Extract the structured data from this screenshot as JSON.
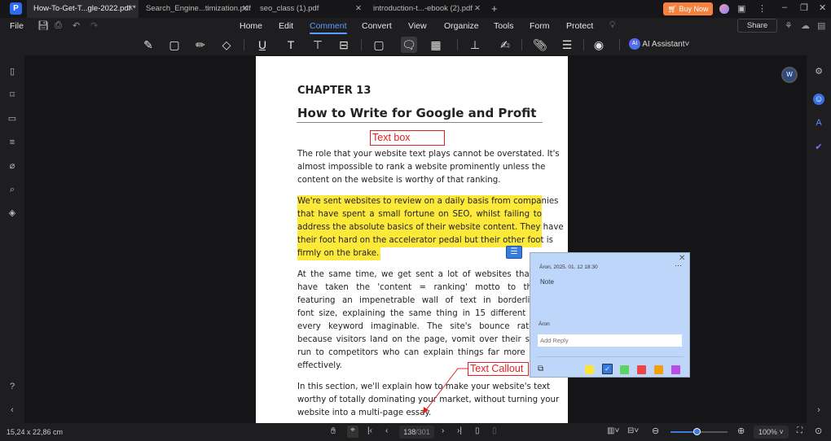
{
  "tabs": [
    {
      "label": "How-To-Get-T...gle-2022.pdf *",
      "active": true
    },
    {
      "label": "Search_Engine...timization.pdf"
    },
    {
      "label": "seo_class (1).pdf"
    },
    {
      "label": "introduction-t...-ebook (2).pdf"
    }
  ],
  "buy_now": "Buy Now",
  "menu": {
    "file": "File",
    "items": [
      "Home",
      "Edit",
      "Comment",
      "Convert",
      "View",
      "Organize",
      "Tools",
      "Form",
      "Protect"
    ],
    "active": "Comment",
    "share": "Share"
  },
  "toolbar": {
    "ai_label": "AI Assistant",
    "ai_badge": "AI"
  },
  "page": {
    "chapter": "CHAPTER 13",
    "title": "How to Write for Google and Profit",
    "textbox": "Text box",
    "para1": [
      "The role that your website text plays cannot be overstated. It's",
      "almost impossible to rank a website prominently unless the",
      "content on the website is worthy of that ranking."
    ],
    "para2": [
      "We're sent websites to review on a daily basis from companies",
      "that have spent a small fortune on SEO, whilst failing to",
      "address the absolute basics of their website content. They have",
      "their foot hard on the accelerator pedal but their other foot is",
      "firmly on the brake."
    ],
    "para3": [
      "At the same time, we get sent a lot of websites that appear",
      "have taken the 'content = ranking' motto to the extre",
      "featuring an impenetrable wall of text in borderline invis",
      "font size, explaining the same thing in 15 different ways us",
      "every keyword imaginable. The site's bounce rate is hu",
      "because visitors land on the page, vomit over their screens a",
      "run to competitors who can explain things far more simply a",
      "effectively."
    ],
    "para4": [
      "In this section, we'll explain how to make your website's text",
      "worthy of totally dominating your market, without turning your",
      "website into a multi-page essay."
    ],
    "callout": "Text Callout",
    "highlight_color": "#fde93a",
    "annotation_color": "#e02020"
  },
  "note_popup": {
    "header": "Áron,  2025. 01. 12 18:30",
    "note": "Note",
    "author": "Áron",
    "reply_placeholder": "Add Reply",
    "colors": [
      "#f7e53b",
      "#3a7be0",
      "#5fd35f",
      "#ef4444",
      "#f59e0b",
      "#b84de6"
    ],
    "selected_color": "#3a7be0"
  },
  "status": {
    "page_size": "15,24 x 22,86 cm",
    "current_page": "138",
    "total_pages": "/301",
    "zoom": "100%",
    "zoom_fraction": 0.45
  }
}
